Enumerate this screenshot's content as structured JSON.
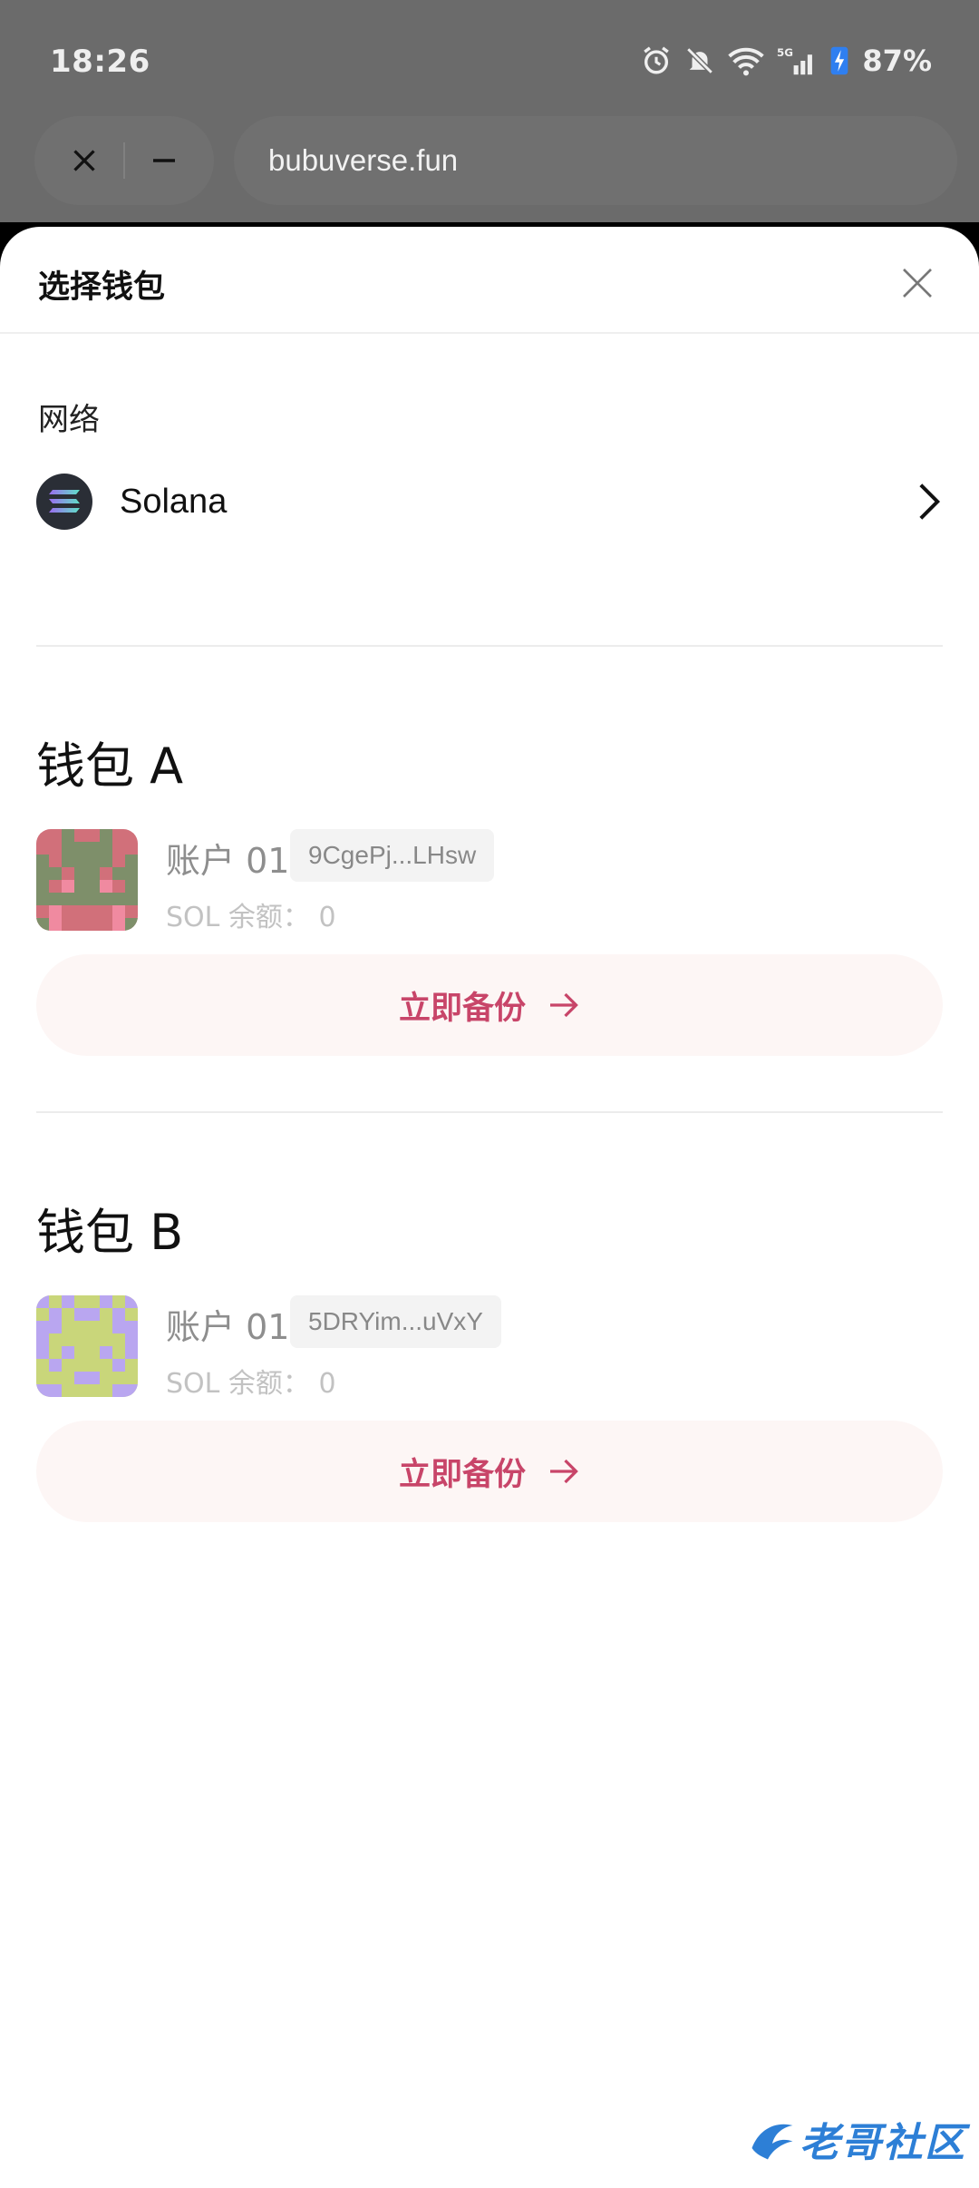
{
  "status_bar": {
    "time": "18:26",
    "network_type": "5G",
    "battery": "87%"
  },
  "browser": {
    "url": "bubuverse.fun"
  },
  "sheet": {
    "title": "选择钱包",
    "network_label": "网络",
    "network": {
      "name": "Solana",
      "icon": "solana-icon"
    },
    "wallets": [
      {
        "title": "钱包 A",
        "account_name": "账户 01",
        "address": "9CgePj...LHsw",
        "balance": "SOL 余额： 0",
        "backup_label": "立即备份"
      },
      {
        "title": "钱包 B",
        "account_name": "账户 01",
        "address": "5DRYim...uVxY",
        "balance": "SOL 余额： 0",
        "backup_label": "立即备份"
      }
    ]
  },
  "colors": {
    "accent": "#c84569",
    "backup_bg": "#fdf6f5",
    "dim_overlay": "#6b6b6b"
  },
  "watermark": {
    "text": "老哥社区"
  }
}
